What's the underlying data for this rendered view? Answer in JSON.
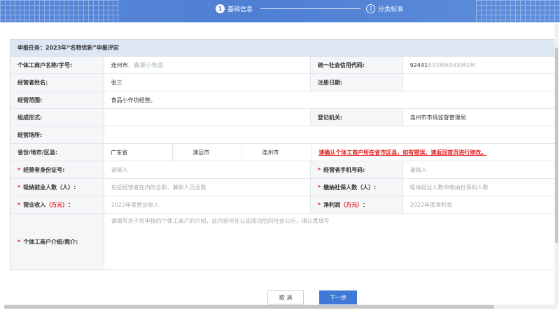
{
  "steps": [
    {
      "num": "1",
      "label": "基础信息"
    },
    {
      "num": "2",
      "label": "分类标准"
    }
  ],
  "panel": {
    "title": "申报任务：2023年“名特优新”申报评定"
  },
  "form": {
    "business_name": {
      "label": "个体工商户名称/字号:",
      "value": "连州市"
    },
    "credit_code": {
      "label": "统一社会信用代码:",
      "value": "92441"
    },
    "operator_name": {
      "label": "经营者姓名:",
      "value": "张三"
    },
    "register_date": {
      "label": "注册日期:",
      "value": ""
    },
    "scope": {
      "label": "经营范围:",
      "value": "食品小作坊经营。"
    },
    "org_form": {
      "label": "组成形式:",
      "value": ""
    },
    "authority": {
      "label": "登记机关:",
      "value": "连州市市场监督管理局"
    },
    "location": {
      "label": "经营场所:",
      "value": ""
    },
    "region": {
      "label": "省份/地市/区县:",
      "province": "广东省",
      "city": "清远市",
      "county": "连州市",
      "notice": "请确认个体工商户所在省市区县，如有错误，请返回首页进行修改。"
    },
    "id_number": {
      "label": "经营者身份证号:",
      "placeholder": "请输入"
    },
    "phone": {
      "label": "经营者手机号码:",
      "placeholder": "请输入"
    },
    "employees": {
      "label": "吸纳就业人数（人）:",
      "placeholder": "包括经营者在内的全职、兼职人员总数"
    },
    "insured": {
      "label": "缴纳社保人数（人）:",
      "placeholder": "吸纳就业人数中缴纳社保的人数"
    },
    "revenue": {
      "label_pre": "营业收入",
      "label_unit": "（万元）",
      "label_post": "：",
      "placeholder": "2022年度营业收入"
    },
    "profit": {
      "label_pre": "净利润",
      "label_unit": "（万元）",
      "label_post": "：",
      "placeholder": "2022年度净利润"
    },
    "intro": {
      "label": "个体工商户介绍/简介:",
      "placeholder": "请填写关于您申报的个体工商户的介绍，此内容将在认定成功后向社会公示，请认真填写"
    }
  },
  "buttons": {
    "cancel": "取 消",
    "next": "下一步"
  },
  "required_mark": "*",
  "colors": {
    "accent": "#3f78d6",
    "required": "#e02020",
    "header_bg": "#dde7f3"
  }
}
